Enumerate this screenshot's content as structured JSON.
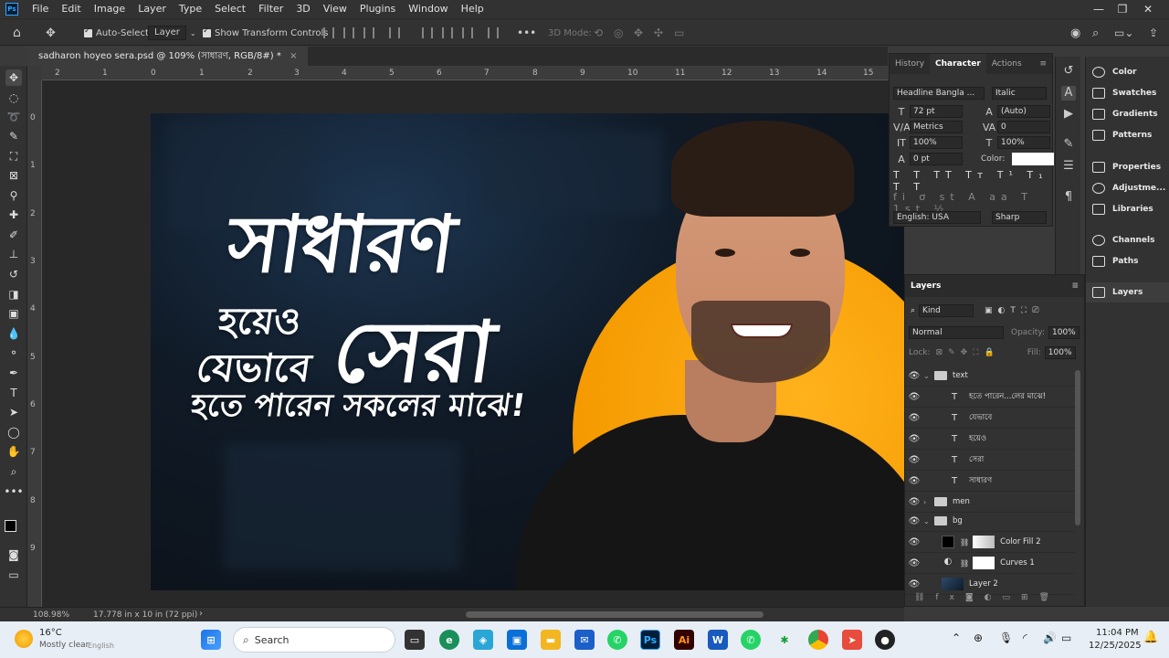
{
  "menubar": {
    "items": [
      "File",
      "Edit",
      "Image",
      "Layer",
      "Type",
      "Select",
      "Filter",
      "3D",
      "View",
      "Plugins",
      "Window",
      "Help"
    ],
    "window_controls": [
      "—",
      "❐",
      "✕"
    ]
  },
  "options": {
    "auto_select_label": "Auto-Select:",
    "auto_select_value": "Layer",
    "show_transform_label": "Show Transform Controls",
    "mode_3d_label": "3D Mode:",
    "more": "•••"
  },
  "document": {
    "tab_title": "sadharon hoyeo sera.psd @ 109% (সাধারণ, RGB/8#) *",
    "close": "×"
  },
  "rulers": {
    "horizontal": [
      "2",
      "1",
      "0",
      "1",
      "2",
      "3",
      "4",
      "5",
      "6",
      "7",
      "8",
      "9",
      "10",
      "11",
      "12",
      "13",
      "14",
      "15"
    ],
    "vertical": [
      "0",
      "1",
      "2",
      "3",
      "4",
      "5",
      "6",
      "7",
      "8",
      "9"
    ]
  },
  "canvas": {
    "line1": "সাধারণ",
    "line2": "হয়েও",
    "line3": "সেরা",
    "line4": "যেভাবে",
    "line5": "হতে পারেন সকলের মাঝে!"
  },
  "status": {
    "zoom": "108.98%",
    "doc_size": "17.778 in x 10 in (72 ppi)"
  },
  "character_panel": {
    "tabs": [
      "History",
      "Character",
      "Actions"
    ],
    "active_tab": "Character",
    "font_family": "Headline Bangla ...",
    "font_style": "Italic",
    "font_size": "72 pt",
    "leading": "(Auto)",
    "kerning": "Metrics",
    "tracking": "0",
    "vertical_scale": "100%",
    "horizontal_scale": "100%",
    "baseline_shift": "0 pt",
    "color_label": "Color:",
    "color_value": "#ffffff",
    "language": "English: USA",
    "antialias": "Sharp"
  },
  "panel_list": [
    {
      "label": "Color",
      "icon": "color-wheel-icon"
    },
    {
      "label": "Swatches",
      "icon": "swatches-grid-icon"
    },
    {
      "label": "Gradients",
      "icon": "gradient-icon"
    },
    {
      "label": "Patterns",
      "icon": "pattern-icon"
    },
    {
      "label": "Properties",
      "icon": "sliders-icon"
    },
    {
      "label": "Adjustme...",
      "icon": "half-circle-icon"
    },
    {
      "label": "Libraries",
      "icon": "library-icon"
    },
    {
      "label": "Channels",
      "icon": "channels-icon"
    },
    {
      "label": "Paths",
      "icon": "pen-path-icon"
    },
    {
      "label": "Layers",
      "icon": "layers-stack-icon"
    }
  ],
  "layers_panel": {
    "title": "Layers",
    "filter": "Kind",
    "blend_mode": "Normal",
    "opacity_label": "Opacity:",
    "opacity": "100%",
    "lock_label": "Lock:",
    "fill_label": "Fill:",
    "fill": "100%",
    "layers": [
      {
        "name": "text",
        "kind": "group",
        "expanded": true
      },
      {
        "name": "হতে পারেন...লের মাঝে!",
        "kind": "type"
      },
      {
        "name": "যেভাবে",
        "kind": "type"
      },
      {
        "name": "হয়েও",
        "kind": "type"
      },
      {
        "name": "সেরা",
        "kind": "type"
      },
      {
        "name": "সাধারণ",
        "kind": "type"
      },
      {
        "name": "men",
        "kind": "group",
        "expanded": false
      },
      {
        "name": "bg",
        "kind": "group",
        "expanded": true
      },
      {
        "name": "Color Fill 2",
        "kind": "fill"
      },
      {
        "name": "Curves 1",
        "kind": "adjustment"
      },
      {
        "name": "Layer 2",
        "kind": "pixel"
      }
    ]
  },
  "taskbar": {
    "weather_temp": "16°C",
    "weather_desc": "Mostly clear",
    "search_placeholder": "Search",
    "time": "11:04 PM",
    "date": "12/25/2025",
    "lang": "English"
  },
  "colors": {
    "accent": "#31a8ff",
    "canvas_orange": "#f59a00",
    "foreground_swatch": "#000000",
    "background_swatch": "#31c8f0"
  }
}
